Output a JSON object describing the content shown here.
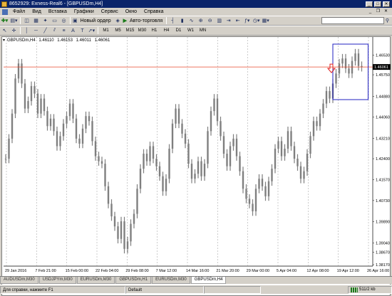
{
  "window": {
    "title": "8652929: Exness-Real6 - [GBPUSDm,H4]"
  },
  "menu": {
    "items": [
      "Файл",
      "Вид",
      "Вставка",
      "Графики",
      "Сервис",
      "Окно",
      "Справка"
    ]
  },
  "toolbar": {
    "new_order_label": "Новый ордер",
    "auto_trading_label": "Авто-торговля",
    "timeframes": [
      "M1",
      "M5",
      "M15",
      "M30",
      "H1",
      "H4",
      "D1",
      "W1",
      "MN"
    ],
    "text_tool": "A",
    "label_tool": "T"
  },
  "chart": {
    "symbol": "GBPUSDm,H4",
    "ohlc": [
      "1.46110",
      "1.46153",
      "1.46011",
      "1.46061"
    ],
    "current_price": "1.46061",
    "colors": {
      "candles": "#7f7f7f",
      "price_line": "#e8492c",
      "box": "#2020c0",
      "arrow": "#e02020",
      "price_tag_bg": "#000000"
    }
  },
  "chart_data": {
    "type": "line",
    "title": "GBPUSDm,H4",
    "xlabel": "",
    "ylabel": "",
    "x": [
      "29 Jan 2016",
      "7 Feb 21:00",
      "15 Feb 00:00",
      "22 Feb 04:00",
      "29 Feb 08:00",
      "7 Mar 12:00",
      "14 Mar 16:00",
      "21 Mar 20:00",
      "29 Mar 00:00",
      "5 Apr 04:00",
      "12 Apr 08:00",
      "19 Apr 12:00",
      "26 Apr 16:00"
    ],
    "y_ticks": [
      "1.46530",
      "1.46061",
      "1.45750",
      "1.44880",
      "1.44060",
      "1.43210",
      "1.42400",
      "1.41570",
      "1.40730",
      "1.39890",
      "1.39040",
      "1.38670",
      "1.38170"
    ],
    "ylim": [
      1.3817,
      1.4703
    ],
    "grid": true,
    "series": [
      {
        "values": [
          1.424,
          1.432,
          1.442,
          1.456,
          1.462,
          1.454,
          1.444,
          1.447,
          1.453,
          1.45,
          1.442,
          1.448,
          1.443,
          1.437,
          1.44,
          1.435,
          1.429,
          1.433,
          1.438,
          1.441,
          1.446,
          1.44,
          1.432,
          1.43,
          1.436,
          1.441,
          1.439,
          1.431,
          1.425,
          1.423,
          1.422,
          1.413,
          1.406,
          1.401,
          1.397,
          1.392,
          1.399,
          1.388,
          1.391,
          1.398,
          1.402,
          1.412,
          1.42,
          1.426,
          1.423,
          1.429,
          1.424,
          1.421,
          1.417,
          1.411,
          1.416,
          1.428,
          1.438,
          1.444,
          1.438,
          1.434,
          1.43,
          1.422,
          1.416,
          1.418,
          1.423,
          1.417,
          1.422,
          1.435,
          1.443,
          1.448,
          1.439,
          1.433,
          1.426,
          1.421,
          1.429,
          1.432,
          1.425,
          1.419,
          1.412,
          1.408,
          1.406,
          1.403,
          1.412,
          1.416,
          1.413,
          1.409,
          1.415,
          1.42,
          1.428,
          1.431,
          1.425,
          1.428,
          1.435,
          1.429,
          1.424,
          1.421,
          1.416,
          1.419,
          1.426,
          1.433,
          1.439,
          1.437,
          1.442,
          1.446,
          1.451,
          1.448,
          1.454,
          1.458,
          1.462,
          1.464,
          1.46,
          1.458,
          1.463,
          1.466,
          1.461,
          1.4606
        ]
      }
    ]
  },
  "tabs": [
    "AUDUSDm,M30",
    "USDJPYm,M30",
    "EURUSDm,M30",
    "GBPUSDm,H1",
    "EURUSDm,M30",
    "GBPUSDm,H4"
  ],
  "active_tab": 5,
  "status": {
    "help": "Для справки, нажмите F1",
    "profile": "Default",
    "traffic": "511/2 kb"
  }
}
